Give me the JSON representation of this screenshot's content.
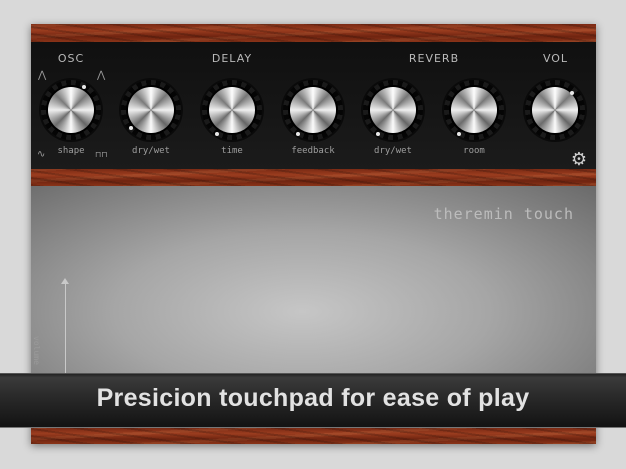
{
  "sections": {
    "osc": {
      "title": "OSC",
      "knobs": [
        {
          "label": "shape"
        }
      ]
    },
    "delay": {
      "title": "DELAY",
      "knobs": [
        {
          "label": "dry/wet"
        },
        {
          "label": "time"
        },
        {
          "label": "feedback"
        }
      ]
    },
    "reverb": {
      "title": "REVERB",
      "knobs": [
        {
          "label": "dry/wet"
        },
        {
          "label": "room"
        }
      ]
    },
    "vol": {
      "title": "VOL"
    }
  },
  "waveform_icons": {
    "sawtooth_left": "⋀",
    "triangle_right": "⋀",
    "sine": "∿",
    "square": "⊓⊓"
  },
  "settings_icon": "⚙",
  "touchpad": {
    "title": "theremin touch",
    "axis_label": "volume"
  },
  "banner": {
    "text": "Presicion touchpad for ease of play"
  }
}
